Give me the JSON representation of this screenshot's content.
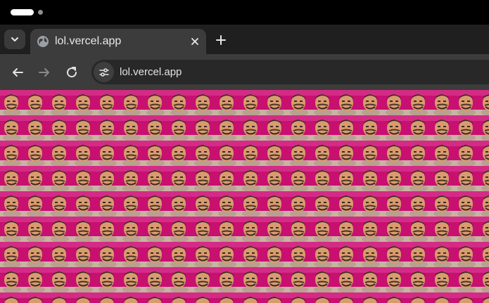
{
  "tab": {
    "title": "lol.vercel.app",
    "favicon": "globe-icon",
    "close_icon": "close-icon"
  },
  "toolbar": {
    "tab_menu_icon": "chevron-down-icon",
    "new_tab_icon": "plus-icon",
    "back_icon": "arrow-left-icon",
    "forward_icon": "arrow-right-icon",
    "reload_icon": "reload-icon",
    "site_info_icon": "tune-icon"
  },
  "omnibox": {
    "url": "lol.vercel.app"
  },
  "page": {
    "content": "repeating tiled face image on magenta background",
    "colors": {
      "background": "#c81070",
      "tile_floor": "#c9b3a4",
      "skin": "#d99b6e",
      "hair": "#3b2a22"
    }
  }
}
